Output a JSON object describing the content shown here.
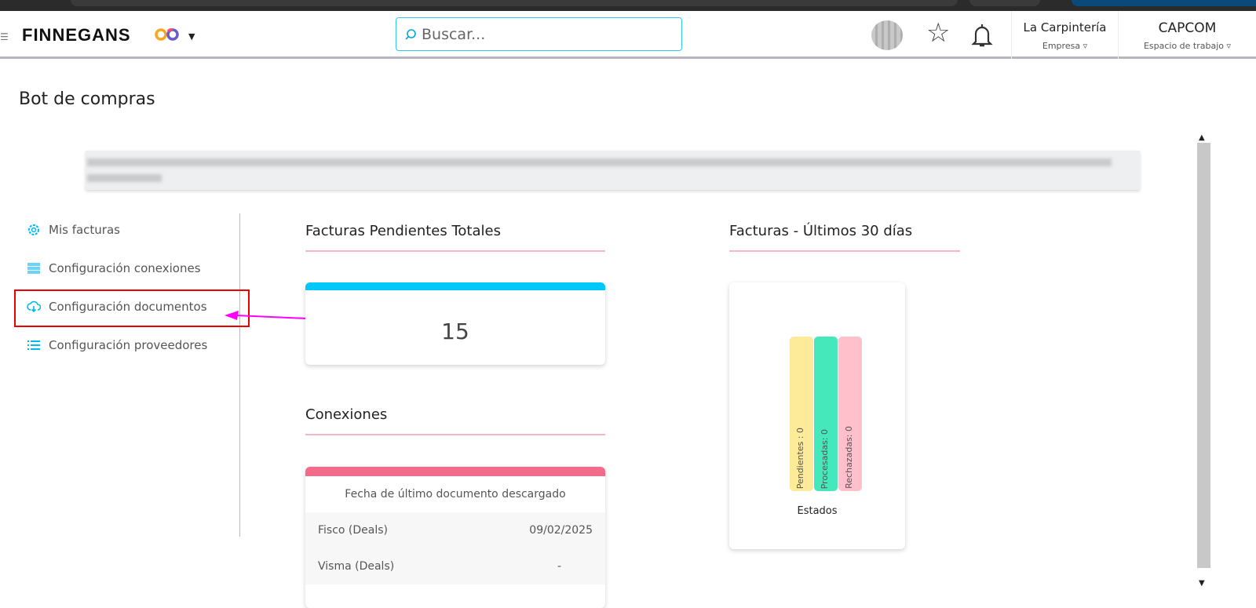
{
  "header": {
    "logo": "FINNEGANS",
    "search_placeholder": "Buscar...",
    "company": {
      "name": "La Carpintería",
      "label": "Empresa"
    },
    "workspace": {
      "name": "CAPCOM",
      "label": "Espacio de trabajo"
    }
  },
  "page": {
    "title": "Bot de compras"
  },
  "sidebar": {
    "items": [
      {
        "label": "Mis facturas",
        "icon": "gear-icon"
      },
      {
        "label": "Configuración conexiones",
        "icon": "server-icon"
      },
      {
        "label": "Configuración documentos",
        "icon": "cloud-download-icon"
      },
      {
        "label": "Configuración proveedores",
        "icon": "list-icon"
      }
    ]
  },
  "pending": {
    "title": "Facturas Pendientes Totales",
    "value": "15",
    "accent": "#00c8f8"
  },
  "connections": {
    "title": "Conexiones",
    "header": "Fecha de último documento descargado",
    "accent": "#f46a8a",
    "rows": [
      {
        "name": "Fisco (Deals)",
        "date": "09/02/2025"
      },
      {
        "name": "Visma (Deals)",
        "date": "-"
      }
    ]
  },
  "chart_data": {
    "type": "bar",
    "title": "Facturas - Últimos 30 días",
    "xlabel": "Estados",
    "categories": [
      "Pendientes : 0",
      "Procesadas: 0",
      "Rechazadas: 0"
    ],
    "values": [
      0,
      0,
      0
    ],
    "colors": [
      "#fdeb9a",
      "#45e8bb",
      "#ffc0cc"
    ]
  }
}
